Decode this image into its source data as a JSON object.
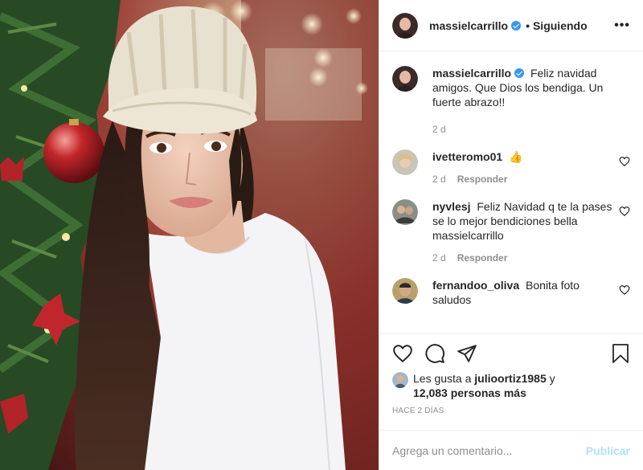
{
  "post": {
    "username": "massielcarrillo",
    "follow_status": "Siguiendo",
    "more_symbol": "•••",
    "separator": "•",
    "caption": "Feliz navidad amigos. Que Dios los bendiga. Un fuerte abrazo!!",
    "caption_age": "2 d"
  },
  "comments": [
    {
      "username": "ivetteromo01",
      "text": "👍",
      "age": "2 d",
      "reply_label": "Responder"
    },
    {
      "username": "nyvlesj",
      "text": "Feliz Navidad q te la pases se lo mejor bendiciones bella massielcarrillo",
      "age": "2 d",
      "reply_label": "Responder"
    },
    {
      "username": "fernandoo_oliva",
      "text": "Bonita foto saludos",
      "age": "",
      "reply_label": ""
    }
  ],
  "likes": {
    "prefix": "Les gusta a",
    "liked_by": "julioortiz1985",
    "joiner": "y",
    "others": "12,083 personas más"
  },
  "date_label": "HACE 2 DÍAS",
  "add_comment": {
    "placeholder": "Agrega un comentario...",
    "post_label": "Publicar"
  },
  "icons": {
    "like": "heart-icon",
    "comment": "comment-icon",
    "share": "share-icon",
    "save": "bookmark-icon",
    "more": "more-options-icon",
    "verified": "verified-badge-icon"
  },
  "colors": {
    "verified": "#3897f0",
    "publish_disabled": "#b2dffc",
    "muted": "#8e8e8e"
  }
}
